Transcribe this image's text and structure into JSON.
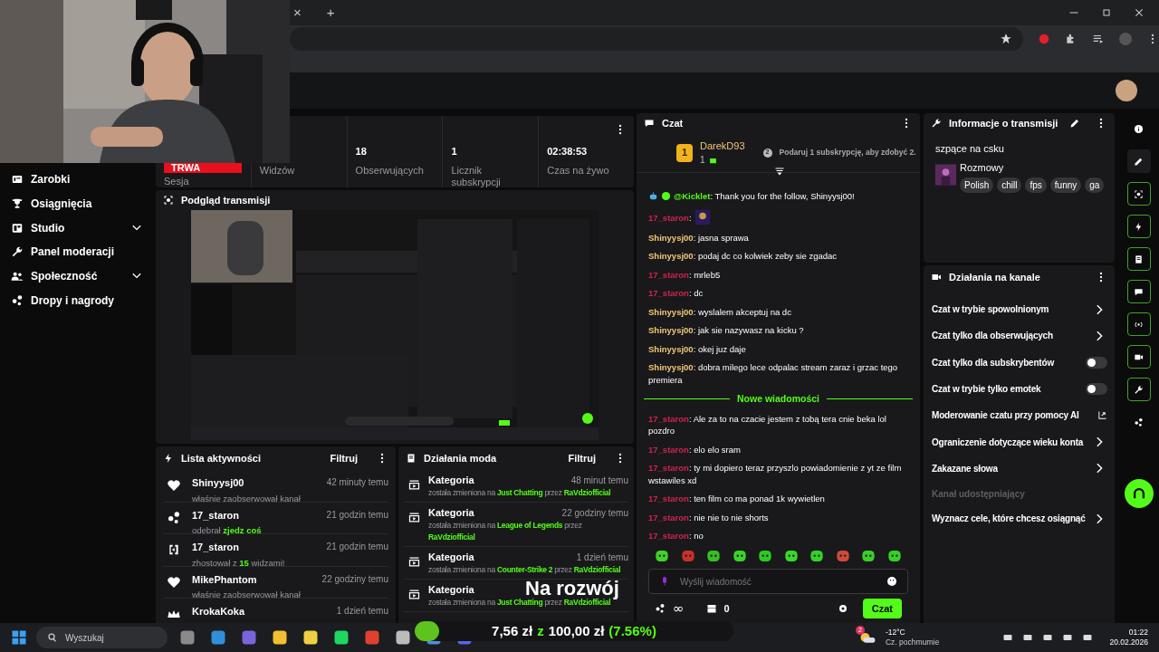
{
  "browser": {
    "tab_buttons": [
      "×",
      "+"
    ]
  },
  "sidebar": {
    "items": [
      {
        "kind": "wallet",
        "label": "Zarobki",
        "expandable": false
      },
      {
        "kind": "trophy",
        "label": "Osiągnięcia",
        "expandable": false
      },
      {
        "kind": "studio",
        "label": "Studio",
        "expandable": true
      },
      {
        "kind": "wrench",
        "label": "Panel moderacji",
        "expandable": false
      },
      {
        "kind": "people",
        "label": "Społeczność",
        "expandable": true
      },
      {
        "kind": "drops",
        "label": "Dropy i nagrody",
        "expandable": false
      }
    ]
  },
  "stats": [
    {
      "kind": "session",
      "badge": "TRWA",
      "label": "Sesja"
    },
    {
      "kind": "hidden",
      "label": "Widzów"
    },
    {
      "kind": "value",
      "value": "18",
      "label": "Obserwujących"
    },
    {
      "kind": "value",
      "value": "1",
      "label": "Licznik subskrypcji"
    },
    {
      "kind": "value",
      "value": "02:38:53",
      "label": "Czas na żywo"
    }
  ],
  "preview": {
    "title": "Podgląd transmisji"
  },
  "activity": {
    "title": "Lista aktywności",
    "filter": "Filtruj",
    "items": [
      {
        "kind": "follow",
        "name": "Shinyysj00",
        "time": "42 minuty temu",
        "desc": [
          {
            "text": "właśnie zaobserwował kanał",
            "highlight": false
          }
        ]
      },
      {
        "kind": "drop",
        "name": "17_staron",
        "time": "21 godzin temu",
        "desc": [
          {
            "text": "odebrał ",
            "highlight": false
          },
          {
            "text": "zjedz coś",
            "highlight": true
          }
        ]
      },
      {
        "kind": "host",
        "name": "17_staron",
        "time": "21 godzin temu",
        "desc": [
          {
            "text": "zhostował z ",
            "highlight": false
          },
          {
            "text": "15",
            "highlight": true
          },
          {
            "text": " widzami!",
            "highlight": false
          }
        ]
      },
      {
        "kind": "follow",
        "name": "MikePhantom",
        "time": "22 godziny temu",
        "desc": [
          {
            "text": "właśnie zaobserwował kanał",
            "highlight": false
          }
        ]
      },
      {
        "kind": "subscription",
        "name": "KrokaKoka",
        "time": "1 dzień temu"
      }
    ]
  },
  "mod_actions": {
    "title": "Działania moda",
    "filter": "Filtruj",
    "items": [
      {
        "title": "Kategoria",
        "time": "48 minut temu",
        "desc": [
          {
            "text": "została zmieniona na ",
            "highlight": false
          },
          {
            "text": "Just Chatting",
            "highlight": true
          },
          {
            "text": " przez ",
            "highlight": false
          },
          {
            "text": "RaVdziofficial",
            "highlight": true
          }
        ]
      },
      {
        "title": "Kategoria",
        "time": "22 godziny temu",
        "desc": [
          {
            "text": "została zmieniona na ",
            "highlight": false
          },
          {
            "text": "League of Legends",
            "highlight": true
          },
          {
            "text": " przez ",
            "highlight": false
          },
          {
            "text": "RaVdziofficial",
            "highlight": true
          }
        ]
      },
      {
        "title": "Kategoria",
        "time": "1 dzień temu",
        "desc": [
          {
            "text": "została zmieniona na ",
            "highlight": false
          },
          {
            "text": "Counter-Strike 2",
            "highlight": true
          },
          {
            "text": " przez ",
            "highlight": false
          },
          {
            "text": "RaVdziofficial",
            "highlight": true
          }
        ]
      },
      {
        "title": "Kategoria",
        "desc": [
          {
            "text": "została zmieniona na ",
            "highlight": false
          },
          {
            "text": "Just Chatting",
            "highlight": true
          },
          {
            "text": " przez ",
            "highlight": false
          },
          {
            "text": "RaVdziofficial",
            "highlight": true
          }
        ]
      }
    ]
  },
  "chat": {
    "title": "Czat",
    "leader": {
      "rank": "1",
      "name": "DarekD93",
      "count": "1"
    },
    "gift": {
      "badge": "2",
      "text": "Podaruj 1 subskrypcję, aby zdobyć 2."
    },
    "messages": [
      {
        "kind": "bot",
        "user": "@Kicklet",
        "color": "#53fc18",
        "text": ": Thank you for the follow, Shinyysj00!"
      },
      {
        "kind": "emote",
        "user": "17_staron",
        "color": "#d0234f",
        "text": ":"
      },
      {
        "kind": "text",
        "user": "Shinyysj00",
        "color": "#f1c77a",
        "text": ": jasna sprawa"
      },
      {
        "kind": "text",
        "user": "Shinyysj00",
        "color": "#f1c77a",
        "text": ": podaj dc co kolwiek zeby sie zgadac"
      },
      {
        "kind": "text",
        "user": "17_staron",
        "color": "#d0234f",
        "text": ": mrleb5"
      },
      {
        "kind": "text",
        "user": "17_staron",
        "color": "#d0234f",
        "text": ": dc"
      },
      {
        "kind": "text",
        "user": "Shinyysj00",
        "color": "#f1c77a",
        "text": ": wyslalem akceptuj na dc"
      },
      {
        "kind": "text",
        "user": "Shinyysj00",
        "color": "#f1c77a",
        "text": ": jak sie nazywasz na kicku ?"
      },
      {
        "kind": "text",
        "user": "Shinyysj00",
        "color": "#f1c77a",
        "text": ": okej juz daje"
      },
      {
        "kind": "text",
        "user": "Shinyysj00",
        "color": "#f1c77a",
        "text": ": dobra milego lece odpalac stream zaraz i grzac tego premiera"
      },
      {
        "kind": "divider",
        "text": "Nowe wiadomości"
      },
      {
        "kind": "text",
        "user": "17_staron",
        "color": "#d0234f",
        "text": ": Ale za to na czacie jestem z tobą tera cnie beka lol pozdro"
      },
      {
        "kind": "text",
        "user": "17_staron",
        "color": "#d0234f",
        "text": ": elo elo sram"
      },
      {
        "kind": "text",
        "user": "17_staron",
        "color": "#d0234f",
        "text": ": ty mi dopiero teraz przyszlo powiadomienie z yt ze film wstawiles xd"
      },
      {
        "kind": "text",
        "user": "17_staron",
        "color": "#d0234f",
        "text": ": ten film co ma ponad 1k wywietlen"
      },
      {
        "kind": "text",
        "user": "17_staron",
        "color": "#d0234f",
        "text": ": nie nie to nie shorts"
      },
      {
        "kind": "text",
        "user": "17_staron",
        "color": "#d0234f",
        "text": ": no"
      }
    ],
    "input": {
      "placeholder": "Wyślij wiadomość"
    },
    "points": "∞",
    "chests": "0",
    "send": "Czat"
  },
  "stream_info": {
    "title": "Informacje o transmisji",
    "stream_title": "szpące na csku",
    "category": "Rozmowy",
    "tags": [
      "Polish",
      "chill",
      "fps",
      "funny",
      "ga"
    ]
  },
  "channel_actions": {
    "title": "Działania na kanale",
    "items": [
      {
        "kind": "arrow",
        "label": "Czat w trybie spowolnionym"
      },
      {
        "kind": "arrow",
        "label": "Czat tylko dla obserwujących"
      },
      {
        "kind": "toggle",
        "label": "Czat tylko dla subskrybentów",
        "on": false
      },
      {
        "kind": "toggle",
        "label": "Czat w trybie tylko emotek",
        "on": false
      },
      {
        "kind": "external",
        "label": "Moderowanie czatu przy pomocy AI"
      },
      {
        "kind": "arrow",
        "label": "Ograniczenie dotyczące wieku konta"
      },
      {
        "kind": "arrow",
        "label": "Zakazane słowa"
      },
      {
        "kind": "heading",
        "label": "Kanał udostępniający"
      },
      {
        "kind": "arrow",
        "label": "Wyznacz cele, które chcesz osiągnąć"
      }
    ]
  },
  "rail": [
    {
      "kind": "info",
      "outlined": false
    },
    {
      "kind": "pencil",
      "outlined": false
    },
    {
      "kind": "preview",
      "outlined": true
    },
    {
      "kind": "bolt",
      "outlined": true
    },
    {
      "kind": "notes",
      "outlined": true
    },
    {
      "kind": "chat",
      "outlined": true
    },
    {
      "kind": "broadcast",
      "outlined": true
    },
    {
      "kind": "mod",
      "outlined": true
    },
    {
      "kind": "wrench",
      "outlined": true
    },
    {
      "kind": "drops",
      "outlined": false
    }
  ],
  "goal": {
    "title": "Na rozwój",
    "amount": "7,56 zł",
    "sep": "z",
    "target": "100,00 zł",
    "percent": "(7.56%)",
    "level": 0.0756
  },
  "taskbar": {
    "search": "Wyszukaj",
    "weather_temp": "-12°C",
    "weather_desc": "Cz. pochmurnie",
    "weather_badge": "2",
    "time": "01:22",
    "date": "20.02.2026"
  }
}
